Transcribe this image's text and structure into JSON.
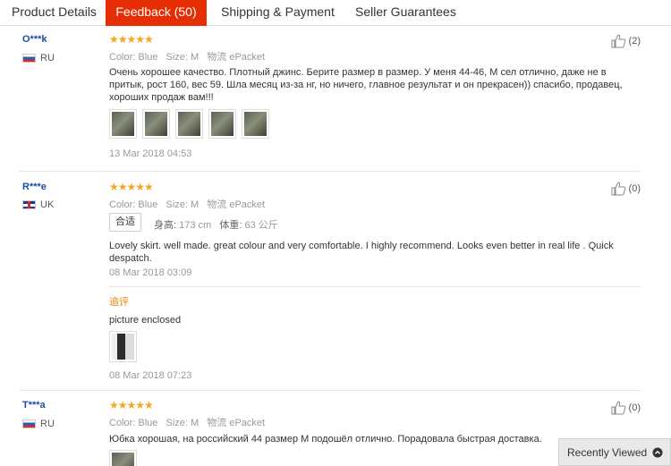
{
  "tabs": [
    {
      "label": "Product Details",
      "active": false
    },
    {
      "label": "Feedback (50)",
      "active": true
    },
    {
      "label": "Shipping & Payment",
      "active": false
    },
    {
      "label": "Seller Guarantees",
      "active": false
    }
  ],
  "labels": {
    "color": "Color:",
    "size": "Size:",
    "shipping": "物流",
    "fit": "合适",
    "height": "身高:",
    "weight": "体重:",
    "additional": "追评"
  },
  "reviews": [
    {
      "user": "O***k",
      "country": "RU",
      "stars": "★★★★★",
      "color": "Blue",
      "size": "M",
      "shipping": "ePacket",
      "likes": "(2)",
      "text": "Очень хорошее качество. Плотный джинс. Берите размер в размер. У меня 44-46, М сел отлично, даже не в притык, рост 160, вес 59. Шла месяц из-за нг, но ничего, главное результат и он прекрасен)) спасибо, продавец, хороших продаж вам!!!",
      "date": "13 Mar 2018 04:53"
    },
    {
      "user": "R***e",
      "country": "UK",
      "stars": "★★★★★",
      "color": "Blue",
      "size": "M",
      "shipping": "ePacket",
      "likes": "(0)",
      "height_val": "173 cm",
      "weight_val": "63 公斤",
      "text": "Lovely skirt. well made. great colour and very comfortable. I highly recommend. Looks even better in real life . Quick despatch.",
      "date": "08 Mar 2018 03:09",
      "additional_text": "picture enclosed",
      "additional_date": "08 Mar 2018 07:23"
    },
    {
      "user": "T***a",
      "country": "RU",
      "stars": "★★★★★",
      "color": "Blue",
      "size": "M",
      "shipping": "ePacket",
      "likes": "(0)",
      "text": "Юбка хорошая, на российский 44 размер М подошёл отлично. Порадовала быстрая доставка."
    }
  ],
  "recently_viewed": "Recently Viewed"
}
